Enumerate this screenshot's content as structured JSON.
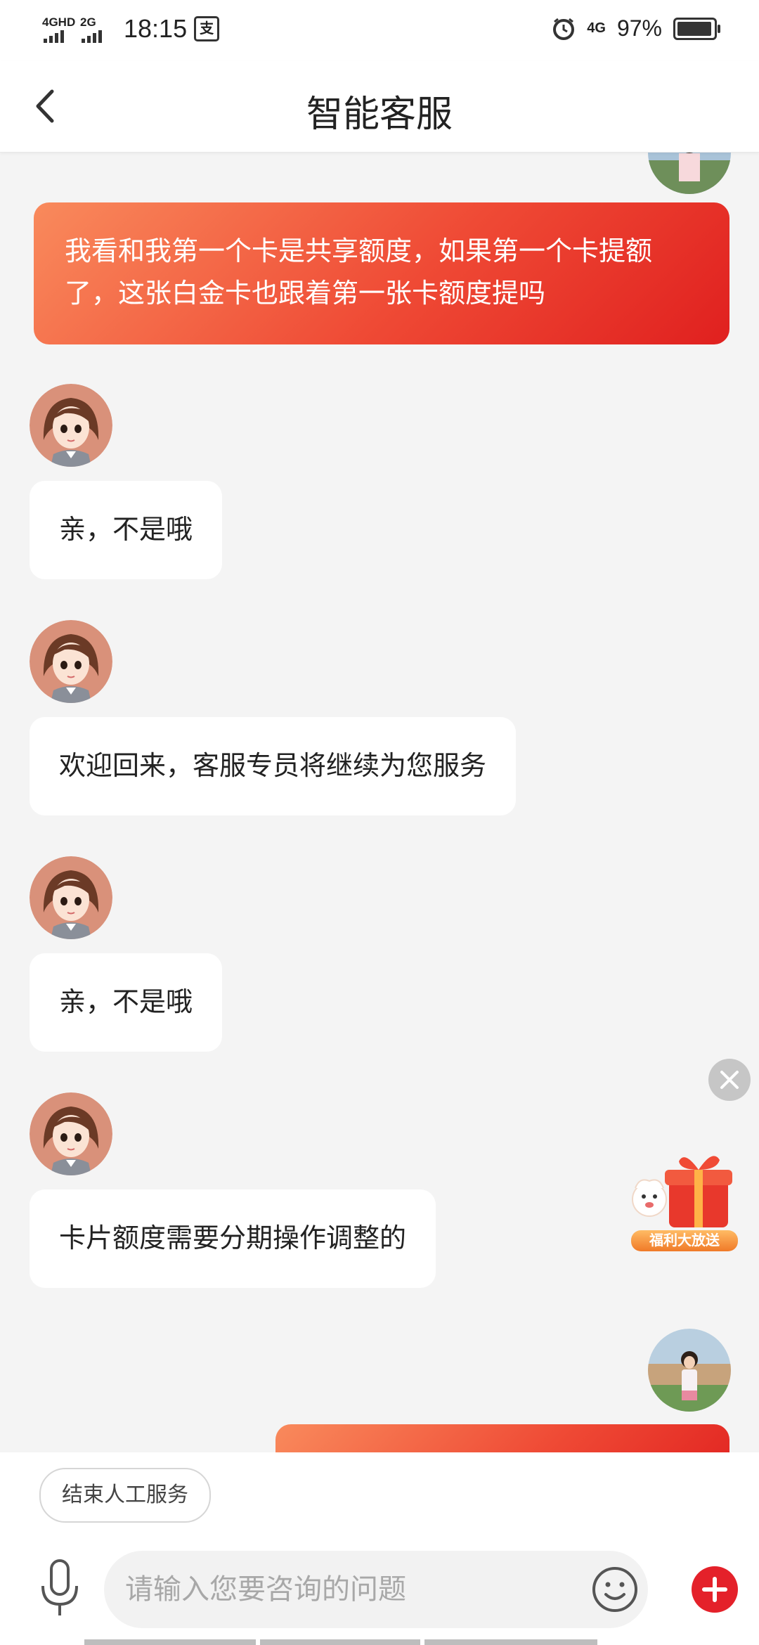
{
  "status_bar": {
    "network1": "4GHD",
    "network2": "2G",
    "time": "18:15",
    "app_icon": "支",
    "network3": "4G",
    "battery": "97%"
  },
  "nav": {
    "title": "智能客服",
    "back_icon": "chevron-left-icon"
  },
  "messages": [
    {
      "role": "user",
      "text": "我看和我第一个卡是共享额度，如果第一个卡提额了，这张白金卡也跟着第一张卡额度提吗"
    },
    {
      "role": "agent",
      "text": "亲，不是哦"
    },
    {
      "role": "agent",
      "text": "欢迎回来，客服专员将继续为您服务"
    },
    {
      "role": "agent",
      "text": "亲，不是哦"
    },
    {
      "role": "agent",
      "text": "卡片额度需要分期操作调整的"
    }
  ],
  "promo": {
    "label": "福利大放送"
  },
  "bottom": {
    "quick_action": "结束人工服务",
    "input_placeholder": "请输入您要咨询的问题"
  },
  "colors": {
    "accent_red": "#e4212a",
    "user_bubble_start": "#f98a5c",
    "user_bubble_end": "#e0201f",
    "background": "#f4f4f4"
  }
}
